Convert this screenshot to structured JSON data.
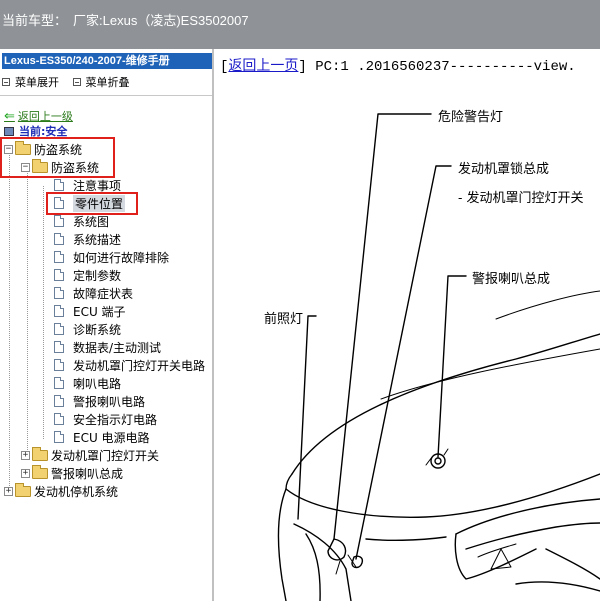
{
  "header": {
    "label": "当前车型：",
    "value": "厂家:Lexus（凌志)ES3502007"
  },
  "sidebar": {
    "manual_title": "Lexus-ES350/240-2007-维修手册",
    "expand_label": "菜单展开",
    "collapse_label": "菜单折叠",
    "back_label": "返回上一级",
    "current_label": "当前:安全",
    "tree": [
      {
        "label": "防盗系统",
        "type": "folder",
        "state": "-"
      },
      {
        "label": "防盗系统",
        "type": "folder",
        "state": "-"
      },
      {
        "label": "注意事项",
        "type": "doc"
      },
      {
        "label": "零件位置",
        "type": "doc",
        "selected": true
      },
      {
        "label": "系统图",
        "type": "doc"
      },
      {
        "label": "系统描述",
        "type": "doc"
      },
      {
        "label": "如何进行故障排除",
        "type": "doc"
      },
      {
        "label": "定制参数",
        "type": "doc"
      },
      {
        "label": "故障症状表",
        "type": "doc"
      },
      {
        "label": "ECU 端子",
        "type": "doc"
      },
      {
        "label": "诊断系统",
        "type": "doc"
      },
      {
        "label": "数据表/主动测试",
        "type": "doc"
      },
      {
        "label": "发动机罩门控灯开关电路",
        "type": "doc"
      },
      {
        "label": "喇叭电路",
        "type": "doc"
      },
      {
        "label": "警报喇叭电路",
        "type": "doc"
      },
      {
        "label": "安全指示灯电路",
        "type": "doc"
      },
      {
        "label": "ECU 电源电路",
        "type": "doc"
      },
      {
        "label": "发动机罩门控灯开关",
        "type": "folder",
        "state": "+"
      },
      {
        "label": "警报喇叭总成",
        "type": "folder",
        "state": "+"
      },
      {
        "label": "发动机停机系统",
        "type": "folder",
        "state": "+"
      }
    ]
  },
  "content": {
    "back_link": "返回上一页",
    "pc_text": "PC:1 .2016560237----------view.",
    "callouts": {
      "hazard": "危险警告灯",
      "hood_lock": "发动机罩锁总成",
      "hood_switch": "- 发动机罩门控灯开关",
      "alarm_horn": "警报喇叭总成",
      "headlight": "前照灯"
    }
  },
  "colors": {
    "topbar": "#8f9397",
    "title_bar": "#1f63b8",
    "highlight_box": "#e0201b",
    "link": "#1a1ac8"
  }
}
